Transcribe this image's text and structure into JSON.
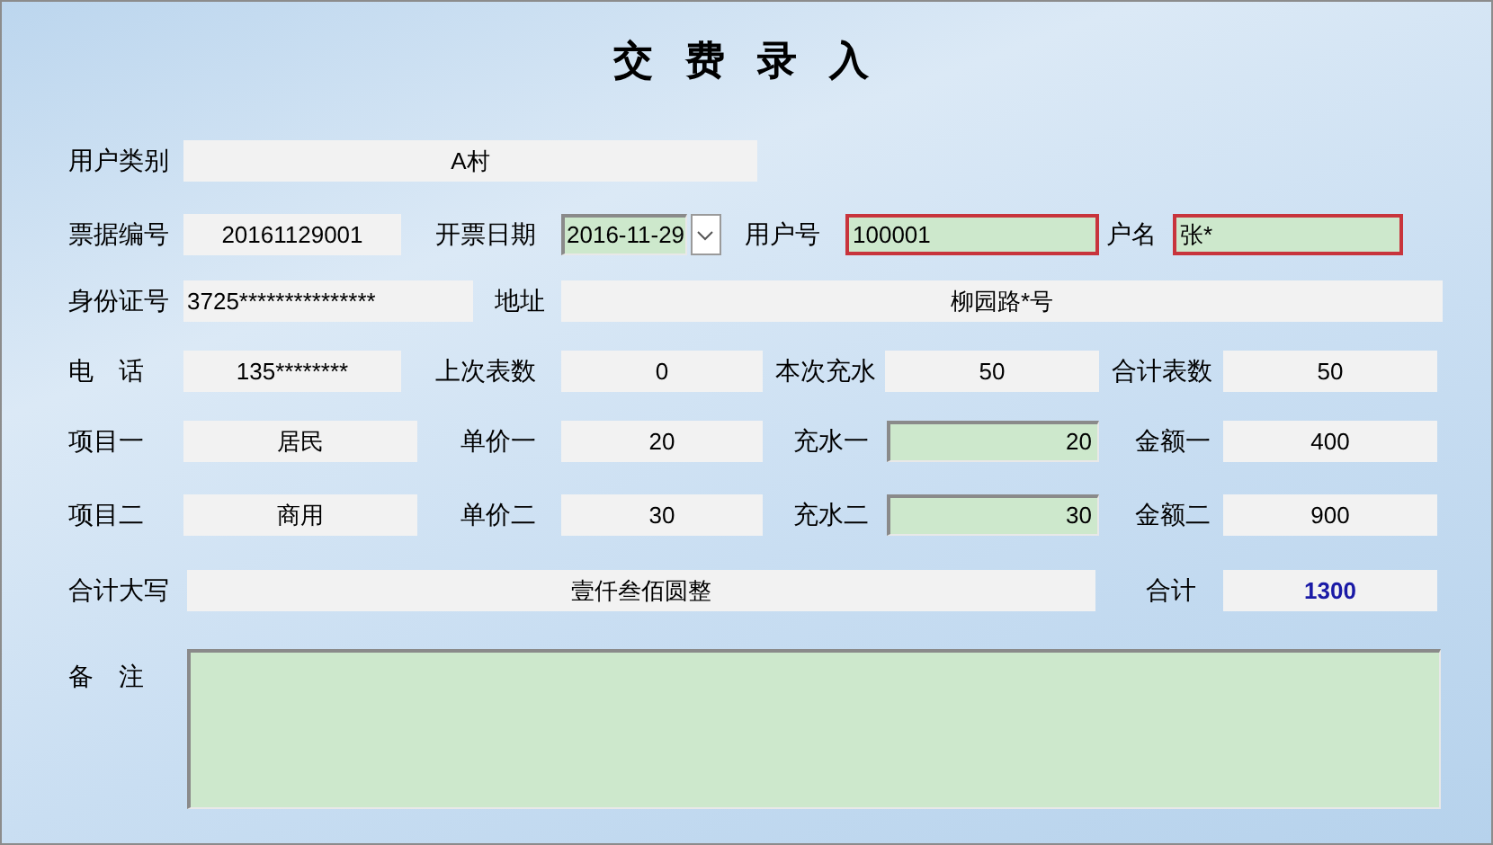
{
  "title": "交 费 录 入",
  "rows": [
    [
      {
        "label": "用户类别",
        "value": "A村",
        "kind": "display"
      }
    ],
    [
      {
        "label": "票据编号",
        "value": "20161129001",
        "kind": "display"
      },
      {
        "label": "开票日期",
        "value": "2016-11-29",
        "kind": "date"
      },
      {
        "label": "用户号",
        "value": "100001",
        "kind": "required"
      },
      {
        "label": "户名",
        "value": "张*",
        "kind": "required"
      }
    ],
    [
      {
        "label": "身份证号",
        "value": "3725***************",
        "kind": "display-left"
      },
      {
        "label": "地址",
        "value": "柳园路*号",
        "kind": "display"
      }
    ],
    [
      {
        "label": "电　话",
        "value": "135********",
        "kind": "display"
      },
      {
        "label": "上次表数",
        "value": "0",
        "kind": "display"
      },
      {
        "label": "本次充水",
        "value": "50",
        "kind": "display"
      },
      {
        "label": "合计表数",
        "value": "50",
        "kind": "display"
      }
    ],
    [
      {
        "label": "项目一",
        "value": "居民",
        "kind": "display"
      },
      {
        "label": "单价一",
        "value": "20",
        "kind": "display"
      },
      {
        "label": "充水一",
        "value": "20",
        "kind": "input"
      },
      {
        "label": "金额一",
        "value": "400",
        "kind": "display"
      }
    ],
    [
      {
        "label": "项目二",
        "value": "商用",
        "kind": "display"
      },
      {
        "label": "单价二",
        "value": "30",
        "kind": "display"
      },
      {
        "label": "充水二",
        "value": "30",
        "kind": "input"
      },
      {
        "label": "金额二",
        "value": "900",
        "kind": "display"
      }
    ],
    [
      {
        "label": "合计大写",
        "value": "壹仟叁佰圆整",
        "kind": "display"
      },
      {
        "label": "合计",
        "value": "1300",
        "kind": "total"
      }
    ]
  ],
  "remark": {
    "label": "备　注"
  }
}
